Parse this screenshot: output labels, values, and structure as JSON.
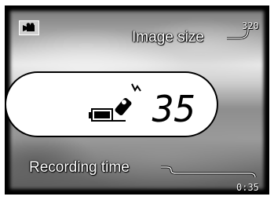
{
  "screen": {
    "mode_icon": "movie-camera-icon",
    "image_size_value": "320",
    "recording_time_value": "0:35"
  },
  "callouts": {
    "image_size": "Image size",
    "recording_time": "Recording time"
  },
  "data_panel": {
    "icons": [
      "battery-icon",
      "card-write-icon"
    ],
    "frame_counter": "35"
  }
}
